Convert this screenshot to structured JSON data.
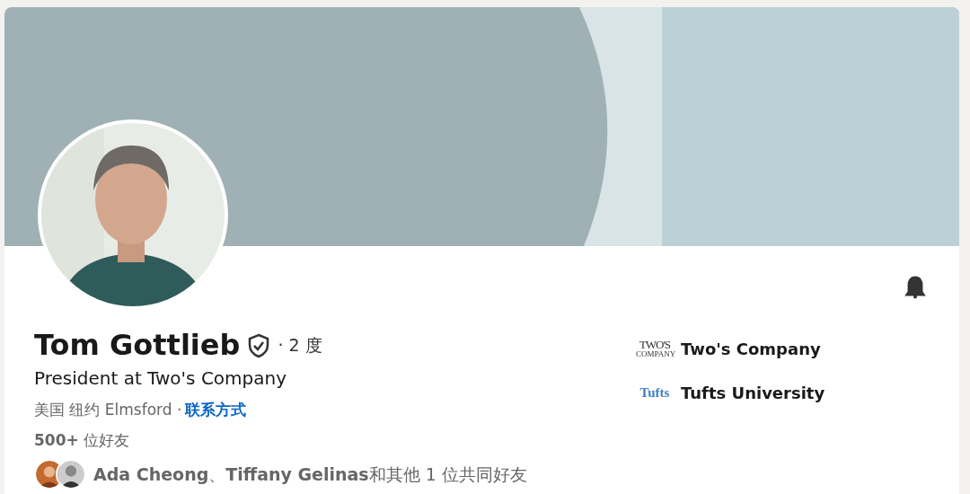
{
  "profile": {
    "name": "Tom Gottlieb",
    "verified": true,
    "degree": "· 2 度",
    "headline": "President at Two's Company",
    "location": "美国 纽约 Elmsford ·",
    "contact_link": "联系方式",
    "connections": "**500+** 位好友",
    "mutual": "**Ada Cheong**、**Tiffany Gelinas**和其他 1 位共同好友",
    "notifications_on": true
  },
  "affiliations": [
    {
      "kind": "company",
      "logo_lines": [
        "TWO'S",
        "COMPANY"
      ],
      "name": "Two's Company"
    },
    {
      "kind": "school",
      "logo_lines": [
        "Tufts"
      ],
      "name": "Tufts University"
    }
  ]
}
